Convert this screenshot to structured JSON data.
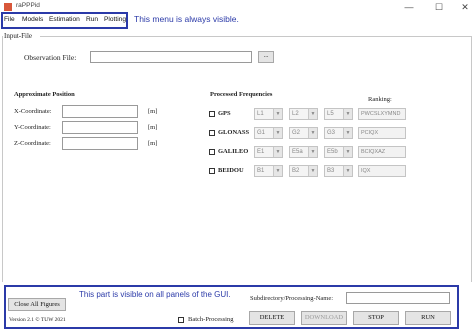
{
  "window": {
    "title": "raPPPid",
    "controls": {
      "minimize": "—",
      "maximize": "☐",
      "close": "✕"
    }
  },
  "menu": {
    "items": [
      "File",
      "Models",
      "Estimation",
      "Run",
      "Plotting"
    ],
    "annotation": "This menu is always visible."
  },
  "panel": {
    "title": "Input-File"
  },
  "observation": {
    "label": "Observation File:",
    "value": "",
    "browse_label": "..."
  },
  "position": {
    "heading": "Approximate Position",
    "x_label": "X-Coordinate:",
    "y_label": "Y-Coordinate:",
    "z_label": "Z-Coordinate:",
    "x_value": "",
    "y_value": "",
    "z_value": "",
    "unit": "[m]"
  },
  "frequencies": {
    "heading": "Processed Frequencies",
    "ranking_label": "Ranking:",
    "rows": [
      {
        "system": "GPS",
        "f1": "L1",
        "f2": "L2",
        "f3": "L5",
        "ranking": "PWCSLXYMND"
      },
      {
        "system": "GLONASS",
        "f1": "G1",
        "f2": "G2",
        "f3": "G3",
        "ranking": "PCIQX"
      },
      {
        "system": "GALILEO",
        "f1": "E1",
        "f2": "E5a",
        "f3": "E5b",
        "ranking": "BCIQXAZ"
      },
      {
        "system": "BEIDOU",
        "f1": "B1",
        "f2": "B2",
        "f3": "B3",
        "ranking": "IQX"
      }
    ]
  },
  "bottom": {
    "annotation": "This part is visible on all panels of the GUI.",
    "close_figures_label": "Close All Figures",
    "version": "Version 2.1 © TUW 2021",
    "batch_label": "Batch-Processing",
    "subdir_label": "Subdirectory/Processing-Name:",
    "subdir_value": "",
    "delete_label": "DELETE",
    "download_label": "DOWNLOAD",
    "stop_label": "STOP",
    "run_label": "RUN"
  },
  "colors": {
    "annotation_border": "#2b3aa8",
    "annotation_text": "#2b3aa8"
  }
}
